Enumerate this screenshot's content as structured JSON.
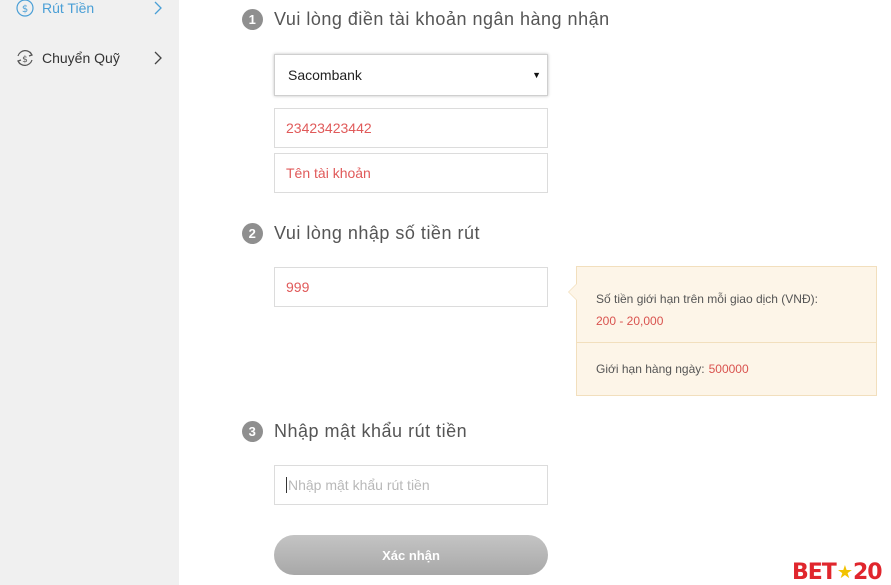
{
  "sidebar": {
    "items": [
      {
        "label": "Rút Tiền",
        "icon": "money-cycle-icon",
        "active": true
      },
      {
        "label": "Chuyển Quỹ",
        "icon": "money-cycle-icon",
        "active": false
      }
    ]
  },
  "steps": {
    "step1": {
      "number": "1",
      "title": "Vui lòng điền tài khoản ngân hàng nhận"
    },
    "step2": {
      "number": "2",
      "title": "Vui lòng nhập số tiền rút"
    },
    "step3": {
      "number": "3",
      "title": "Nhập mật khẩu rút tiền"
    }
  },
  "form": {
    "bank_select": {
      "value": "Sacombank"
    },
    "account_number": {
      "value": "23423423442"
    },
    "account_name": {
      "placeholder": "Tên tài khoản"
    },
    "amount": {
      "value": "999"
    },
    "password": {
      "placeholder": "Nhập mật khẩu rút tiền"
    },
    "submit_label": "Xác nhận"
  },
  "limits": {
    "per_transaction_label": "Số tiền giới hạn trên mỗi giao dịch (VNĐ):",
    "per_transaction_range": "200 - 20,000",
    "daily_label": "Giới hạn hàng ngày:",
    "daily_value": "500000"
  },
  "logo": {
    "text_left": "BET",
    "text_right": "20"
  },
  "colors": {
    "accent_blue": "#4a9fd6",
    "error_red": "#e05a5a",
    "limit_red": "#d9534f",
    "tip_bg": "#fdf5e8"
  }
}
